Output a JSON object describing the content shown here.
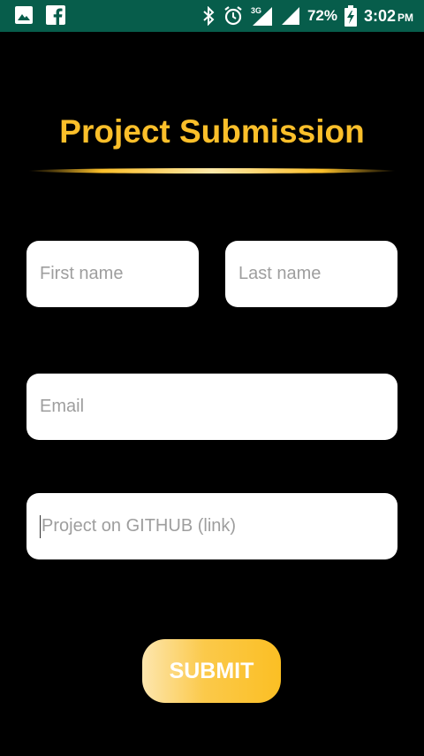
{
  "status_bar": {
    "battery": "72%",
    "time": "3:02",
    "ampm": "PM",
    "network_label": "3G",
    "icons": [
      "image-icon",
      "facebook-icon",
      "bluetooth-icon",
      "alarm-icon",
      "signal-3g-icon",
      "signal-icon",
      "battery-charging-icon"
    ],
    "background_color": "#075d4b"
  },
  "header": {
    "title": "Project Submission",
    "accent_color": "#fbbf2a"
  },
  "form": {
    "first_name": {
      "value": "",
      "placeholder": "First name"
    },
    "last_name": {
      "value": "",
      "placeholder": "Last name"
    },
    "email": {
      "value": "",
      "placeholder": "Email"
    },
    "github": {
      "value": "",
      "placeholder": "Project on GITHUB (link)",
      "focused": true
    }
  },
  "submit": {
    "label": "SUBMIT"
  }
}
